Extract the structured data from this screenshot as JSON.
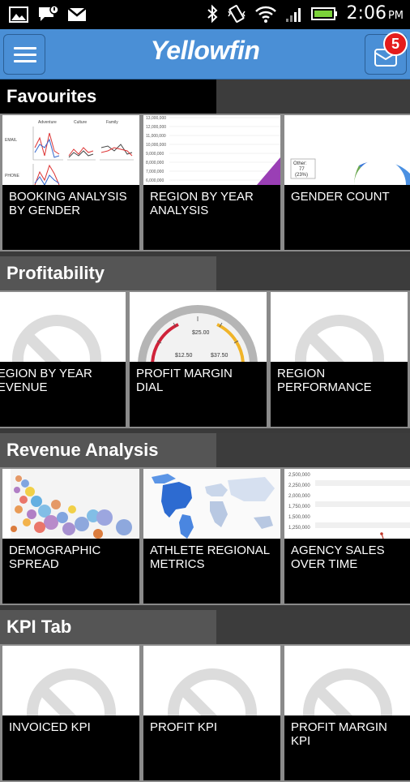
{
  "status_bar": {
    "time": "2:06",
    "ampm": "PM",
    "icons": [
      "image-icon",
      "message-icon",
      "gmail-icon",
      "bluetooth-icon",
      "vibrate-icon",
      "wifi-icon",
      "signal-icon",
      "battery-icon"
    ]
  },
  "app_bar": {
    "logo": "Yellowfin",
    "menu_icon": "hamburger-icon",
    "mail_icon": "mail-icon",
    "notification_count": "5"
  },
  "sections": [
    {
      "title": "Favourites",
      "tiles": [
        {
          "label": "BOOKING ANALYSIS BY GENDER",
          "thumb": "line-chart"
        },
        {
          "label": "REGION BY YEAR ANALYSIS",
          "thumb": "area-chart"
        },
        {
          "label": "GENDER COUNT",
          "thumb": "pie-chart"
        }
      ]
    },
    {
      "title": "Profitability",
      "tiles": [
        {
          "label": "REGION BY YEAR REVENUE",
          "thumb": "no-image"
        },
        {
          "label": "PROFIT MARGIN DIAL",
          "thumb": "dial"
        },
        {
          "label": "REGION PERFORMANCE",
          "thumb": "no-image"
        }
      ]
    },
    {
      "title": "Revenue Analysis",
      "tiles": [
        {
          "label": "DEMOGRAPHIC SPREAD",
          "thumb": "bubble-chart"
        },
        {
          "label": "ATHLETE REGIONAL METRICS",
          "thumb": "map"
        },
        {
          "label": "AGENCY SALES OVER TIME",
          "thumb": "line-chart"
        }
      ]
    },
    {
      "title": "KPI Tab",
      "tiles": [
        {
          "label": "INVOICED KPI",
          "thumb": "no-image"
        },
        {
          "label": "PROFIT KPI",
          "thumb": "no-image"
        },
        {
          "label": "PROFIT MARGIN KPI",
          "thumb": "no-image"
        }
      ]
    }
  ],
  "thumb_text": {
    "booking": {
      "cols": [
        "Adventure",
        "Culture",
        "Family"
      ],
      "rows": [
        "EMAIL",
        "PHONE"
      ]
    },
    "region_axis": [
      "13,000,000",
      "12,000,000",
      "11,000,000",
      "10,000,000",
      "9,000,000",
      "8,000,000",
      "7,000,000",
      "6,000,000"
    ],
    "gender": {
      "label": "Other:",
      "count": "77",
      "pct": "(23%)"
    },
    "dial": {
      "top": "$25.00",
      "left": "$12.50",
      "right": "$37.50"
    },
    "agency_axis": [
      "2,500,000",
      "2,250,000",
      "2,000,000",
      "1,750,000",
      "1,500,000",
      "1,250,000"
    ]
  },
  "colors": {
    "app_bar": "#4a8fd6",
    "badge": "#e41c1c",
    "caption_bg": "#000000"
  }
}
